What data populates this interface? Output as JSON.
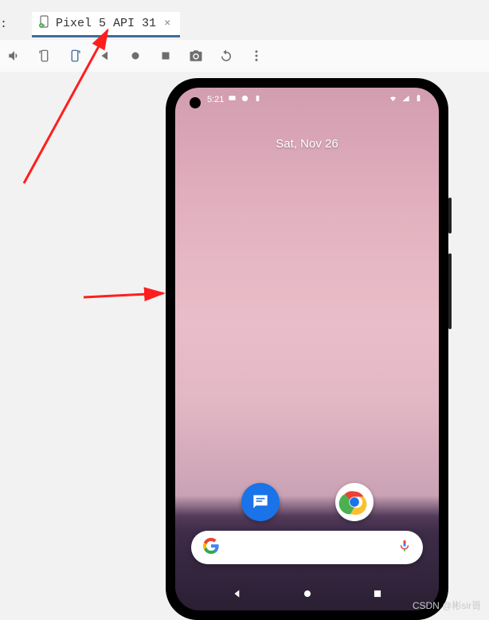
{
  "truncated_label": ":",
  "tab": {
    "label": "Pixel 5 API 31"
  },
  "status": {
    "time": "5:21"
  },
  "phone_date": "Sat, Nov 26",
  "watermark": "CSDN @彬sir哥"
}
